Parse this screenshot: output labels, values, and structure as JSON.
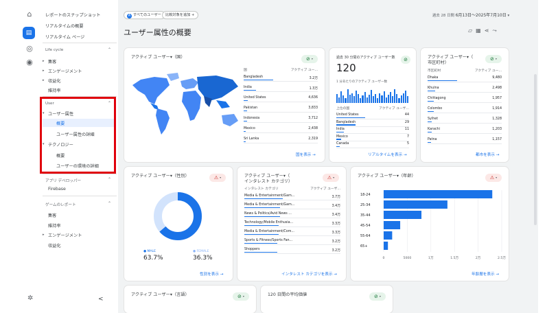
{
  "rail": {
    "icons": [
      "home-icon",
      "reports-icon",
      "explore-icon",
      "advertising-icon"
    ],
    "settings_icon": "gear-icon"
  },
  "nav": {
    "top": [
      "レポートのスナップショット",
      "リアルタイムの概要",
      "リアルタイム ページ"
    ],
    "lifecycle": {
      "title": "Life cycle",
      "items": [
        "集客",
        "エンゲージメント",
        "収益化",
        "維持率"
      ]
    },
    "user": {
      "title": "User",
      "group1": "ユーザー属性",
      "sub1": [
        "概要",
        "ユーザー属性の詳細"
      ],
      "group2": "テクノロジー",
      "sub2": [
        "概要",
        "ユーザーの環境の詳細"
      ]
    },
    "app": {
      "title": "アプリ デベロッパー",
      "items": [
        "Firebase"
      ]
    },
    "games": {
      "title": "ゲームのレポート",
      "items": [
        "集客",
        "維持率",
        "エンゲージメント",
        "収益化"
      ]
    },
    "collapse": "<"
  },
  "toolbar": {
    "chip1": "すべてのユーザー",
    "chip2": "比較対象を追加",
    "chip2_plus": "+",
    "date_prefix": "過去 28 日間",
    "date_range": "6月13日～2025年7月10日",
    "date_caret": "▾"
  },
  "page": {
    "title": "ユーザー属性の概要"
  },
  "cards": {
    "country": {
      "title": "アクティブ ユーザー▾（国）",
      "col1": "国",
      "col2": "アクティブ ユー...",
      "rows": [
        {
          "name": "Bangladesh",
          "value": "3.2万",
          "frac": 1.0
        },
        {
          "name": "India",
          "value": "1.3万",
          "frac": 0.41
        },
        {
          "name": "United States",
          "value": "4,636",
          "frac": 0.15
        },
        {
          "name": "Pakistan",
          "value": "3,833",
          "frac": 0.12
        },
        {
          "name": "Indonesia",
          "value": "3,712",
          "frac": 0.11
        },
        {
          "name": "Mexico",
          "value": "2,438",
          "frac": 0.08
        },
        {
          "name": "Sri Lanka",
          "value": "2,319",
          "frac": 0.07
        }
      ],
      "link": "国を表示 →"
    },
    "realtime": {
      "title": "過去 30 分間のアクティブ ユーザー数",
      "value": "120",
      "sub": "1 分あたりのアクティブ ユーザー数",
      "col1": "上位の国",
      "col2": "アクティブ ユーザ...",
      "bars": [
        0.55,
        0.35,
        0.7,
        0.45,
        0.3,
        0.85,
        0.5,
        0.6,
        0.4,
        0.75,
        0.55,
        0.3,
        0.45,
        0.65,
        0.35,
        0.5,
        0.8,
        0.4,
        0.55,
        0.3,
        0.6,
        0.45,
        0.7,
        0.35,
        0.5,
        0.65,
        0.4,
        0.85,
        0.55,
        0.3,
        0.45,
        0.6,
        0.75,
        0.4
      ],
      "rows": [
        {
          "name": "United States",
          "value": "44",
          "frac": 1.0
        },
        {
          "name": "Bangladesh",
          "value": "29",
          "frac": 0.66
        },
        {
          "name": "India",
          "value": "11",
          "frac": 0.25
        },
        {
          "name": "Mexico",
          "value": "7",
          "frac": 0.16
        },
        {
          "name": "Canada",
          "value": "5",
          "frac": 0.11
        }
      ],
      "link": "リアルタイムを表示 →"
    },
    "city": {
      "title": "アクティブ ユーザー▾（",
      "title2": "市区町村）",
      "col1": "市区町村",
      "col2": "アクティブ ユー...",
      "rows": [
        {
          "name": "Dhaka",
          "value": "9,480",
          "frac": 1.0
        },
        {
          "name": "Khulna",
          "value": "2,498",
          "frac": 0.26
        },
        {
          "name": "Chittagong",
          "value": "1,957",
          "frac": 0.21
        },
        {
          "name": "Colombo",
          "value": "1,914",
          "frac": 0.2
        },
        {
          "name": "Sylhet",
          "value": "1,328",
          "frac": 0.14
        },
        {
          "name": "Karachi",
          "value": "1,203",
          "frac": 0.13
        },
        {
          "name": "Patna",
          "value": "1,157",
          "frac": 0.12
        }
      ],
      "link": "都市を表示 →"
    },
    "gender": {
      "title": "アクティブ ユーザー▾（性別）",
      "male_label": "● MALE",
      "male_value": "63.7%",
      "female_label": "● FEMALE",
      "female_value": "36.3%",
      "male_frac": 0.637,
      "link": "性別を表示 →"
    },
    "interest": {
      "title": "アクティブ ユーザー▾（",
      "title2": "インタレスト カテゴリ）",
      "col1": "インタレスト カテゴリ",
      "col2": "アクティブ ユーザ...",
      "rows": [
        {
          "name": "Media & Entertainment/Gam...",
          "value": "3.7万",
          "frac": 1.0
        },
        {
          "name": "Media & Entertainment/Gam...",
          "value": "3.4万",
          "frac": 0.92
        },
        {
          "name": "News & Politics/Avid News ...",
          "value": "3.4万",
          "frac": 0.92
        },
        {
          "name": "Technology/Mobile Enthusia...",
          "value": "3.3万",
          "frac": 0.89
        },
        {
          "name": "Media & Entertainment/Com...",
          "value": "3.3万",
          "frac": 0.89
        },
        {
          "name": "Sports & Fitness/Sports Fan...",
          "value": "3.2万",
          "frac": 0.86
        },
        {
          "name": "Shoppers",
          "value": "3.2万",
          "frac": 0.86
        }
      ],
      "link": "インタレスト カテゴリを表示 →"
    },
    "age": {
      "title": "アクティブ ユーザー▾（年齢）",
      "categories": [
        "18-24",
        "25-34",
        "35-44",
        "45-54",
        "55-64",
        "65+"
      ],
      "values": [
        23000,
        13500,
        8000,
        3500,
        1800,
        900
      ],
      "xticks": [
        "0",
        "5000",
        "1万",
        "1.5万",
        "2万",
        "2.5万"
      ],
      "xmax": 25000,
      "link": "年齢層を表示 →"
    },
    "language": {
      "title": "アクティブ ユーザー▾（言語）"
    },
    "avgtime": {
      "title": "120 日間の平均価値"
    }
  },
  "chart_data": {
    "type": "bar",
    "categories": [
      "18-24",
      "25-34",
      "35-44",
      "45-54",
      "55-64",
      "65+"
    ],
    "values": [
      23000,
      13500,
      8000,
      3500,
      1800,
      900
    ],
    "title": "アクティブ ユーザー▾（年齢）",
    "xlim": [
      0,
      25000
    ]
  },
  "colors": {
    "accent": "#1a73e8",
    "highlight": "#e8f0fe",
    "redbox": "#e0000b",
    "ok": "#137333",
    "warn": "#c5221f"
  }
}
